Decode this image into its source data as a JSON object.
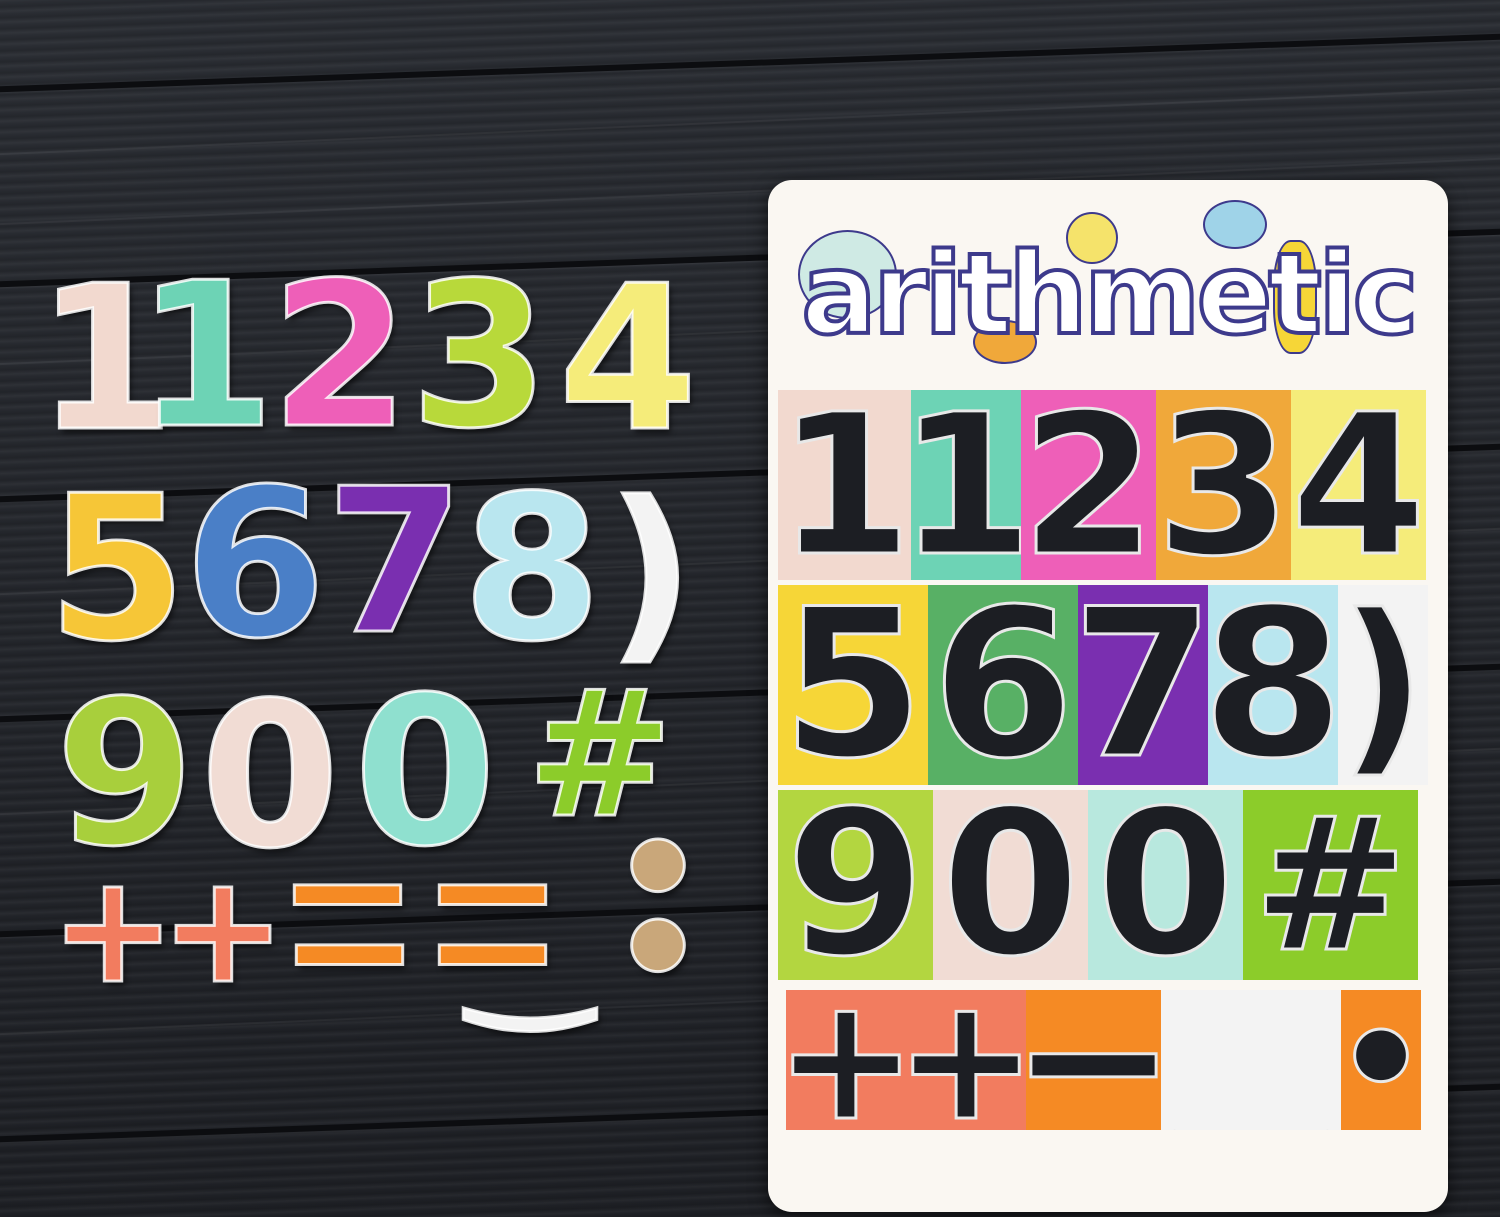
{
  "board": {
    "title": "arithmetic"
  },
  "loose_pieces": [
    {
      "glyph": "1",
      "color": "#f2d9cf"
    },
    {
      "glyph": "1",
      "color": "#6dd3b5"
    },
    {
      "glyph": "2",
      "color": "#ee5fb8"
    },
    {
      "glyph": "3",
      "color": "#b8d93a"
    },
    {
      "glyph": "4",
      "color": "#f5ec7a"
    },
    {
      "glyph": "5",
      "color": "#f6c637"
    },
    {
      "glyph": "6",
      "color": "#4a7fc7"
    },
    {
      "glyph": "7",
      "color": "#7a2fb0"
    },
    {
      "glyph": "8",
      "color": "#b9e6ef"
    },
    {
      "glyph": ")",
      "color": "#f3f3f3"
    },
    {
      "glyph": "9",
      "color": "#a8cf3c"
    },
    {
      "glyph": "0",
      "color": "#f1dcd4"
    },
    {
      "glyph": "0",
      "color": "#8fe0cf"
    },
    {
      "glyph": "#",
      "color": "#8ccc2a"
    },
    {
      "glyph": "+",
      "color": "#f27c5f"
    },
    {
      "glyph": "+",
      "color": "#f27c5f"
    },
    {
      "glyph": "−",
      "color": "#f58a24"
    },
    {
      "glyph": "−",
      "color": "#f58a24"
    },
    {
      "glyph": "−",
      "color": "#f58a24"
    },
    {
      "glyph": "−",
      "color": "#f58a24"
    },
    {
      "glyph": "‿",
      "color": "#f3f3f3"
    },
    {
      "glyph": "•",
      "color": "#c9a77a"
    },
    {
      "glyph": "•",
      "color": "#c9a77a"
    }
  ],
  "board_slots": [
    {
      "glyph": "1",
      "color": "#f2d9cf"
    },
    {
      "glyph": "1",
      "color": "#6dd3b5"
    },
    {
      "glyph": "2",
      "color": "#ee5fb8"
    },
    {
      "glyph": "3",
      "color": "#f0a83a"
    },
    {
      "glyph": "4",
      "color": "#f5ec7a"
    },
    {
      "glyph": "5",
      "color": "#f6d637"
    },
    {
      "glyph": "6",
      "color": "#58b065"
    },
    {
      "glyph": "7",
      "color": "#7a2fb0"
    },
    {
      "glyph": "8",
      "color": "#b9e6ef"
    },
    {
      "glyph": ")",
      "color": "#f3f3f3"
    },
    {
      "glyph": "9",
      "color": "#b3d640"
    },
    {
      "glyph": "0",
      "color": "#f1dcd4"
    },
    {
      "glyph": "0",
      "color": "#b8e8de"
    },
    {
      "glyph": "#",
      "color": "#8ccc2a"
    },
    {
      "glyph": "+",
      "color": "#f27c5f"
    },
    {
      "glyph": "+",
      "color": "#f27c5f"
    },
    {
      "glyph": "−",
      "color": "#f58a24"
    },
    {
      "glyph": "‿",
      "color": "#f3f3f3"
    },
    {
      "glyph": "•",
      "color": "#f58a24"
    }
  ]
}
